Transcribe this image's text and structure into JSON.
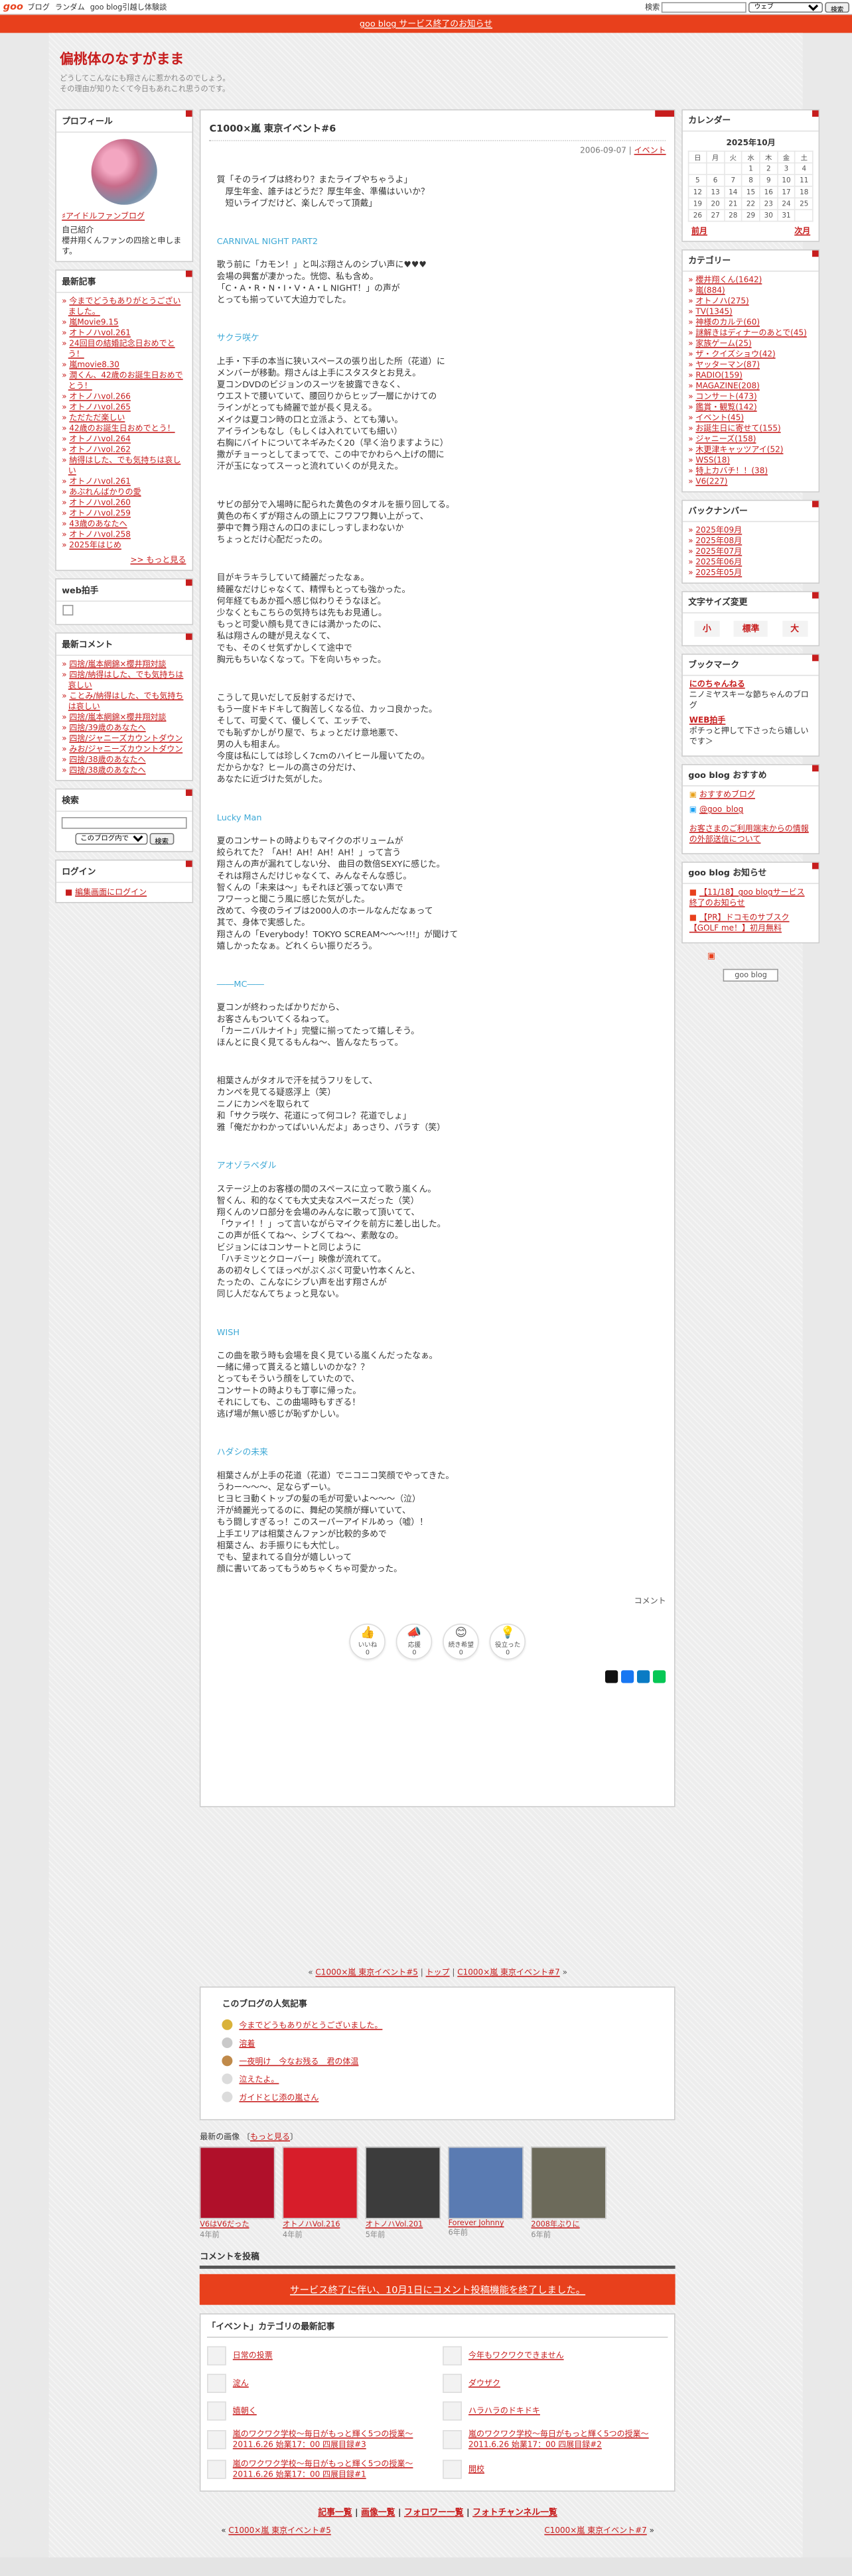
{
  "topbar": {
    "logo": "goo",
    "links": [
      "ブログ",
      "ランダム",
      "goo blog引越し体験談"
    ],
    "search_label": "検索",
    "search_scope": "ウェブ",
    "search_btn": "検索"
  },
  "notice": "goo blog サービス終了のお知らせ",
  "blog": {
    "title": "偏桃体のなすがまま",
    "desc1": "どうしてこんなにも翔さんに惹かれるのでしょう。",
    "desc2": "その理由が知りたくて今日もあれこれ思うのです。"
  },
  "profile": {
    "title": "プロフィール",
    "name": "♯アイドルファンブログ",
    "intro_label": "自己紹介",
    "intro": "櫻井翔くんファンの四捨と申します。"
  },
  "recent": {
    "title": "最新記事",
    "items": [
      "今までどうもありがとうございました。",
      "嵐Movie9.15",
      "オトノハvol.261",
      "24回目の結婚記念日おめでとう！",
      "嵐movie8.30",
      "潤くん、42歳のお誕生日おめでとう！",
      "オトノハvol.266",
      "オトノハvol.265",
      "ただただ楽しい",
      "42歳のお誕生日おめでとう！",
      "オトノハvol.264",
      "オトノハvol.262",
      "納得はした、でも気持ちは哀しい",
      "オトノハvol.261",
      "あぶれんばかりの愛",
      "オトノハvol.260",
      "オトノハvol.259",
      "43歳のあなたへ",
      "オトノハvol.258",
      "2025年はじめ"
    ],
    "more": ">> もっと見る"
  },
  "webclap": {
    "title": "web拍手"
  },
  "comments": {
    "title": "最新コメント",
    "items": [
      "四捨/嵐本網錦×櫻井翔対談",
      "四捨/納得はした、でも気持ちは哀しい",
      "ことみ/納得はした、でも気持ちは哀しい",
      "四捨/嵐本網錦×櫻井翔対談",
      "四捨/39歳のあなたへ",
      "四捨/ジャニーズカウントダウン",
      "みお/ジャニーズカウントダウン",
      "四捨/38歳のあなたへ",
      "四捨/38歳のあなたへ"
    ]
  },
  "search": {
    "title": "検索",
    "scope": "このブログ内で",
    "btn": "検索"
  },
  "login": {
    "title": "ログイン",
    "link": "編集画面にログイン"
  },
  "entry": {
    "title": "C1000×嵐 東京イベント#6",
    "date": "2006-09-07",
    "category": "イベント",
    "p1": "質「そのライブは終わり？またライブやちゃうよ」\n　厚生年金、誰チはどうだ？厚生年金、準備はいいか？\n　短いライブだけど、楽しんでって頂戴」",
    "s1": "CARNIVAL NIGHT PART2",
    "p2": "歌う前に「カモン！」と叫ぶ翔さんのシブい声に♥♥♥\n会場の興奮が凄かった。恍惚、私も含め。\n「C・A・R・N・I・V・A・L NIGHT！」の声が\nとっても揃っていて大迫力でした。",
    "s2": "サクラ咲ケ",
    "p3": "上手・下手の本当に狭いスペースの張り出した所（花道）に\nメンバーが移動。翔さんは上手にスタスタとお見え。\n夏コンDVDのビジョンのスーツを披露できなく、\nウエストで腰いていて、腰回りからヒップ一層にかけての\nラインがとっても綺麗で並が長く見える。\nメイクは夏コン時の口と立派よう、とても薄い。\nアイラインもなし（もしくは入れていても細い）\n右胸にバイトについてネギみたく20（早く治りますように）\n撒がチョーっとしてまってで、この中でかわらへ上げの間に\n汗が玉になってスーっと流れていくのが見えた。",
    "p4": "サビの部分で入場時に配られた黄色のタオルを振り回してる。\n黄色の布くずが翔さんの頭上にフワフワ舞い上がって、\n夢中で舞う翔さんの口のまにしっすしまわないか\nちょっとだけ心配だったの。",
    "p5": "目がキラキラしていて綺麗だったなぁ。\n綺麗なだけじゃなくて、精悍もとっても強かった。\n何年経てもあか孤へ感じ似わりそうなほど。\n少なくともこちらの気持ちは先もお見通し。\nもっと可愛い顔も見てきには満かったのに、\n私は翔さんの睫が見えなくて、\nでも、そのくせ気ずかしくて途中で\n胸元もちいなくなって。下を向いちゃった。",
    "p6": "こうして見いだして反射するだけで、\nもう一度ドキドキして胸苦しくなる位、カッコ良かった。\nそして、可愛くて、優しくて、エッチで、\nでも恥ずかしがり屋で、ちょっとだけ意地悪で、\n男の人も相まん。\n今度は私にしては珍しく7cmのハイヒール履いてたの。\nだからかな？ヒールの高さの分だけ、\nあなたに近づけた気がした。",
    "s3": "Lucky Man",
    "p7": "夏のコンサートの時よりもマイクのボリュームが\n絞られてた？「AH！AH！AH！AH！」って言う\n翔さんの声が漏れてしない分、 曲目の数倍SEXYに感じた。\nそれは翔さんだけじゃなくて、みんなそんな感じ。\n智くんの「未来は〜」もそれほど張ってない声で\nフワーっと聞こう風に感じた気がした。\n改めて、今夜のライブは2000人のホールなんだなぁって\n其で、身体で実感した。\n翔さんの「Everybody！TOKYO SCREAM〜〜〜!!!」が聞けて\n嬉しかったなぁ。どれくらい振りだろう。",
    "s4": "――MC――",
    "p8": "夏コンが終わったばかりだから、\nお客さんもついてくるねって。\n「カーニバルナイト」完璧に揃ってたって嬉しそう。\nほんとに良く見てるもんね〜、皆んなたちって。",
    "p9": "相葉さんがタオルで汗を拭うフリをして、\nカンペを見てる疑惑浮上（笑）\nニノにカンペを取られて\n和「サクラ咲ケ、花道にって何コレ？花道でしょ」\n雅「俺だかわかってぱいいんだよ」あっさり、パラす（笑）",
    "s5": "アオゾラペダル",
    "p10": "ステージ上のお客様の間のスペースに立って歌う嵐くん。\n智くん、和的なくても大丈夫なスペースだった（笑）\n翔くんのソロ部分を会場のみんなに歌って頂いてて、\n「ウァイ！！」って言いながらマイクを前方に差し出した。\nこの声が低くてね〜、シブくてね〜、素敵なの。\nビジョンにはコンサートと同じように\n「ハチミツとクローバー」映像が流れてて。\nあの初々しくてほっぺがぷくぷく可愛い竹本くんと、\nたったの、こんなにシブい声を出す翔さんが\n同じ人だなんてちょっと見ない。",
    "s6": "WISH",
    "p11": "この曲を歌う時も会場を良く見ている嵐くんだったなぁ。\n一緒に帰って貰えると嬉しいのかな？？\nとってもそういう顔をしていたので、\nコンサートの時よりも丁寧に帰った。\nそれにしても、この曲場時もすぎる！\n逃げ場が無い感じが恥ずかしい。",
    "s7": "ハダシの未来",
    "p12": "相葉さんが上手の花道（花道）でニコニコ笑顔でやってきた。\nうわー〜〜〜、足ならずーい。\nヒヨヒヨ動くトップの髪の毛が可愛いよ〜〜〜（泣）\n汗が綺麗光ってるのに、舞紀の笑顔が輝いていて、\nもう闘しすぎるっ！このスーパーアイドルめっ（嘘）！\n上手エリアは相葉さんファンが比較的多めで\n相葉さん、お手振りにも大忙し。\nでも、望まれてる自分が嬉しいって\n顔に書いてあってもうめちゃくちゃ可愛かった。",
    "comment_link": "コメント",
    "reactions": [
      {
        "label": "いいね",
        "count": "0"
      },
      {
        "label": "応援",
        "count": "0"
      },
      {
        "label": "続き希望",
        "count": "0"
      },
      {
        "label": "役立った",
        "count": "0"
      }
    ]
  },
  "pager": {
    "prev": "C1000×嵐 東京イベント#5",
    "top": "トップ",
    "next": "C1000×嵐 東京イベント#7"
  },
  "popular": {
    "title": "このブログの人気記事",
    "items": [
      "今までどうもありがとうございました。",
      "溶着",
      "一夜明け　今なお残る　君の体温",
      "泣えたよ。",
      "ガイドとじ添の嵐さん"
    ]
  },
  "recent_images": {
    "title": "最新の画像",
    "more": "もっと見る",
    "items": [
      {
        "label": "V6はV6だった",
        "age": "4年前"
      },
      {
        "label": "オトノハVol.216",
        "age": "4年前"
      },
      {
        "label": "オトノハVol.201",
        "age": "5年前"
      },
      {
        "label": "Forever Johnny",
        "age": "6年前"
      },
      {
        "label": "2008年ぶりに",
        "age": "6年前"
      }
    ]
  },
  "comment_post": {
    "title": "コメントを投稿",
    "end": "サービス終了に伴い、10月1日にコメント投稿機能を終了しました。"
  },
  "cat_latest": {
    "title": "「イベント」カテゴリの最新記事",
    "items": [
      "日常の投票",
      "今年もワクワクできません",
      "淀ん",
      "ダウザク",
      "嬉朝く",
      "ハラハラのドキドキ",
      "嵐のワクワク学校〜毎日がもっと輝く5つの授業〜2011.6.26 始業17：00 四展目録#3",
      "嵐のワクワク学校〜毎日がもっと輝く5つの授業〜2011.6.26 始業17：00 四展目録#2",
      "嵐のワクワク学校〜毎日がもっと輝く5つの授業〜2011.6.26 始業17：00 四展目録#1",
      "開校"
    ]
  },
  "footer": {
    "links": [
      "記事一覧",
      "画像一覧",
      "フォロワー一覧",
      "フォトチャンネル一覧"
    ],
    "prev": "C1000×嵐 東京イベント#5",
    "next": "C1000×嵐 東京イベント#7"
  },
  "calendar": {
    "title": "カレンダー",
    "month": "2025年10月",
    "week": [
      "日",
      "月",
      "火",
      "水",
      "木",
      "金",
      "土"
    ],
    "rows": [
      [
        "",
        "",
        "",
        "1",
        "2",
        "3",
        "4"
      ],
      [
        "5",
        "6",
        "7",
        "8",
        "9",
        "10",
        "11"
      ],
      [
        "12",
        "13",
        "14",
        "15",
        "16",
        "17",
        "18"
      ],
      [
        "19",
        "20",
        "21",
        "22",
        "23",
        "24",
        "25"
      ],
      [
        "26",
        "27",
        "28",
        "29",
        "30",
        "31",
        ""
      ]
    ],
    "prev": "前月",
    "next": "次月"
  },
  "categories": {
    "title": "カテゴリー",
    "items": [
      "櫻井翔くん(1642)",
      "嵐(884)",
      "オトノハ(275)",
      "TV(1345)",
      "神様のカルテ(60)",
      "謎解きはディナーのあとで(45)",
      "家族ゲーム(25)",
      "ザ・クイズショウ(42)",
      "ヤッターマン(87)",
      "RADIO(159)",
      "MAGAZINE(208)",
      "コンサート(473)",
      "鑑賞・観覧(142)",
      "イベント(45)",
      "お誕生日に寄せて(155)",
      "ジャニーズ(158)",
      "木更津キャッツアイ(52)",
      "WSS(18)",
      "特上カバチ！！(38)",
      "V6(227)"
    ]
  },
  "backnumber": {
    "title": "バックナンバー",
    "items": [
      "2025年09月",
      "2025年08月",
      "2025年07月",
      "2025年06月",
      "2025年05月"
    ]
  },
  "fontsize": {
    "title": "文字サイズ変更",
    "small": "小",
    "mid": "標準",
    "large": "大"
  },
  "bookmark": {
    "title": "ブックマーク",
    "i1t": "にのちゃんねる",
    "i1d": "ニノミヤスキーな節ちゃんのブログ",
    "i2t": "WEB拍手",
    "i2d": "ポチっと押して下さったら嬉しいです＞"
  },
  "recommend": {
    "title": "goo blog おすすめ",
    "i1": "おすすめブログ",
    "i2": "@goo_blog",
    "i3": "お客さまのご利用端末からの情報の外部送信について"
  },
  "goonotice": {
    "title": "goo blog お知らせ",
    "i1": "【11/18】goo blogサービス終了のお知らせ",
    "i2": "【PR】ドコモのサブスク【GOLF me！】初月無料"
  },
  "goobadge": "goo blog"
}
